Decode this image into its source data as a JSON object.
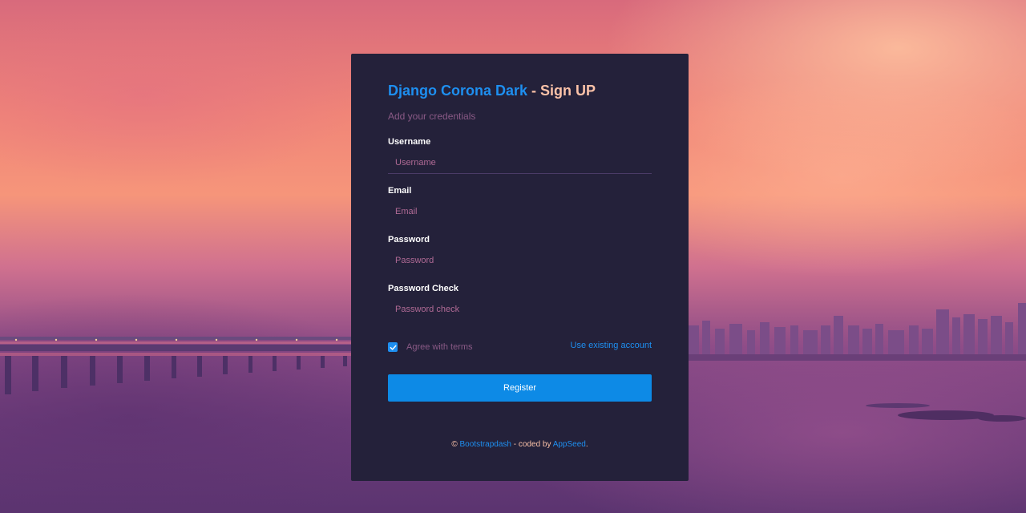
{
  "page": {
    "title_brand": "Django Corona Dark",
    "title_sep": " - ",
    "title_page": "Sign UP",
    "subtitle": "Add your credentials"
  },
  "form": {
    "username": {
      "label": "Username",
      "placeholder": "Username",
      "value": ""
    },
    "email": {
      "label": "Email",
      "placeholder": "Email",
      "value": ""
    },
    "password": {
      "label": "Password",
      "placeholder": "Password",
      "value": ""
    },
    "password_check": {
      "label": "Password Check",
      "placeholder": "Password check",
      "value": ""
    },
    "agree_label": "Agree with terms",
    "agree_checked": true,
    "existing_account_link": "Use existing account",
    "register_button": "Register"
  },
  "footer": {
    "copyright_symbol": "©",
    "link1": "Bootstrapdash",
    "middle": " - coded by ",
    "link2": "AppSeed",
    "end": "."
  },
  "colors": {
    "card_bg": "#24213a",
    "accent": "#1e8ff0",
    "title_peach": "#fbc2a8",
    "muted_pink": "#8a5a86",
    "button": "#0d8ae6"
  },
  "icons": {
    "checkbox": "check-icon"
  }
}
